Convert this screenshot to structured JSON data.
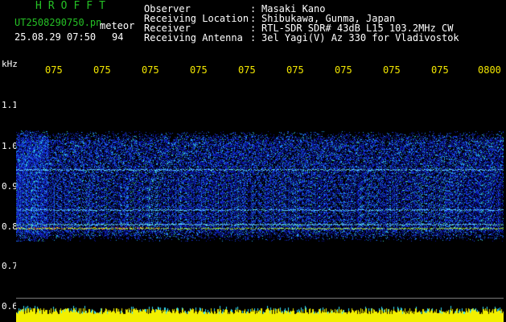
{
  "header": {
    "brand": "HROFFT",
    "filename": "UT2508290750.pn",
    "mode": "meteor",
    "datetime": "25.08.29 07:50",
    "count": "94"
  },
  "info": [
    {
      "label": "Observer",
      "value": "Masaki Kano"
    },
    {
      "label": "Receiving Location",
      "value": "Shibukawa, Gunma, Japan"
    },
    {
      "label": "Receiver",
      "value": "RTL-SDR SDR# 43dB L15 103.2MHz CW"
    },
    {
      "label": "Receiving Antenna",
      "value": "3el Yagi(V) Az 330 for Vladivostok"
    }
  ],
  "colon": ":",
  "yaxis": {
    "unit": "kHz",
    "labels": [
      "1.1",
      "1.0",
      "0.9",
      "0.8",
      "0.7",
      "0.6"
    ]
  },
  "time_labels": [
    "075",
    "075",
    "075",
    "075",
    "075",
    "075",
    "075",
    "075",
    "075",
    "0800"
  ],
  "colors": {
    "text_green": "#25c025",
    "text_yellow": "#f2e600",
    "background": "#000000",
    "spectrum_noise": "#1d2fd8",
    "signal": "#3ad6ff"
  }
}
